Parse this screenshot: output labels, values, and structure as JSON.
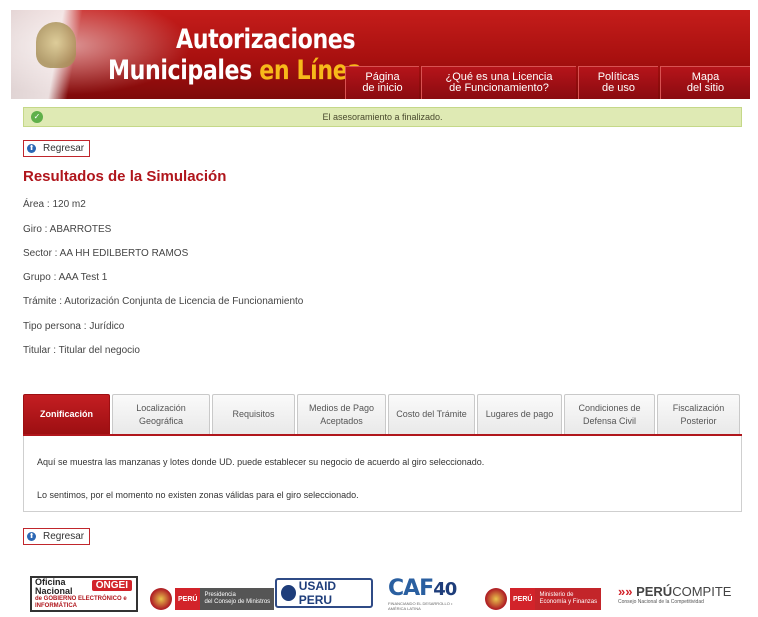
{
  "header": {
    "brand_line1": "Autorizaciones",
    "brand_line2_a": "Municipales",
    "brand_line2_b": "en Línea",
    "nav": [
      {
        "line1": "Página",
        "line2": "de inicio"
      },
      {
        "line1": "¿Qué es una Licencia",
        "line2": "de Funcionamiento?"
      },
      {
        "line1": "Políticas",
        "line2": "de uso"
      },
      {
        "line1": "Mapa",
        "line2": "del sitio"
      }
    ]
  },
  "notice": {
    "text": "El asesoramiento a finalizado.",
    "icon": "check-icon"
  },
  "back_label": "Regresar",
  "page_title": "Resultados de la Simulación",
  "info": [
    "Área : 120 m2",
    "Giro : ABARROTES",
    "Sector : AA HH EDILBERTO RAMOS",
    "Grupo : AAA Test 1",
    "Trámite : Autorización Conjunta de Licencia de Funcionamiento",
    "Tipo persona : Jurídico",
    "Titular : Titular del negocio"
  ],
  "tabs": [
    {
      "line1": "Zonificación",
      "line2": ""
    },
    {
      "line1": "Localización",
      "line2": "Geográfica"
    },
    {
      "line1": "Requisitos",
      "line2": ""
    },
    {
      "line1": "Medios de Pago",
      "line2": "Aceptados"
    },
    {
      "line1": "Costo del Trámite",
      "line2": ""
    },
    {
      "line1": "Lugares de pago",
      "line2": ""
    },
    {
      "line1": "Condiciones de",
      "line2": "Defensa Civil"
    },
    {
      "line1": "Fiscalización",
      "line2": "Posterior"
    }
  ],
  "panel": {
    "p1": "Aquí se muestra las manzanas y lotes donde UD. puede establecer su negocio de acuerdo al giro seleccionado.",
    "p2": "Lo sentimos, por el momento no existen zonas válidas para el giro seleccionado."
  },
  "logos": {
    "ongei": {
      "l1": "Oficina",
      "l2": "Nacional",
      "tag": "ONGEI",
      "l3": "de GOBIERNO ELECTRÓNICO e",
      "l4": "INFORMÁTICA"
    },
    "pcm": {
      "peru": "PERÚ",
      "t1": "Presidencia",
      "t2": "del Consejo de Ministros"
    },
    "usaid": {
      "text": "USAID PERU"
    },
    "caf": {
      "a": "CAF",
      "b": "40",
      "sub": "FINANCIANDO EL DESARROLLO • AMÉRICA LATINA"
    },
    "mef": {
      "peru": "PERÚ",
      "t1": "Ministerio de",
      "t2": "Economía y Finanzas"
    },
    "compite": {
      "a": "PERÚ",
      "b": "COMPITE",
      "sub": "Consejo Nacional de la Competitividad"
    }
  }
}
